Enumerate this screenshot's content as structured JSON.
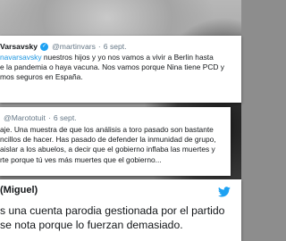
{
  "tweet1": {
    "name": "Varsavsky",
    "handle": "@martinvars",
    "separator": "·",
    "date": "6 sept.",
    "mention": "navarsavsky",
    "line1_rest": "nuestros hijos y yo nos vamos a vivir a Berlin hasta",
    "line2": "e la pandemia o haya vacuna. Nos vamos porque Nina tiene PCD y",
    "line3": "mos seguros en España."
  },
  "tweet2": {
    "handle": "@Marototuit",
    "separator": "·",
    "date": "6 sept.",
    "lines": [
      "aje. Una muestra de que los análisis a toro pasado son bastante",
      "ncillos de hacer. Has pasado de defender la inmunidad de grupo,",
      "aislar a los abuelos, a decir que el gobierno inflaba las muertes y",
      "rte porque tú ves más muertes que el gobierno..."
    ]
  },
  "tweet3": {
    "name": "(Miguel)",
    "lines": [
      "s una cuenta parodia gestionada por el partido",
      "se nota porque lo fuerzan demasiado."
    ],
    "icon": "twitter-bird-icon"
  },
  "colors": {
    "twitter_blue": "#1da1f2",
    "link_blue": "#1b95e0",
    "muted_gray": "#657786"
  }
}
